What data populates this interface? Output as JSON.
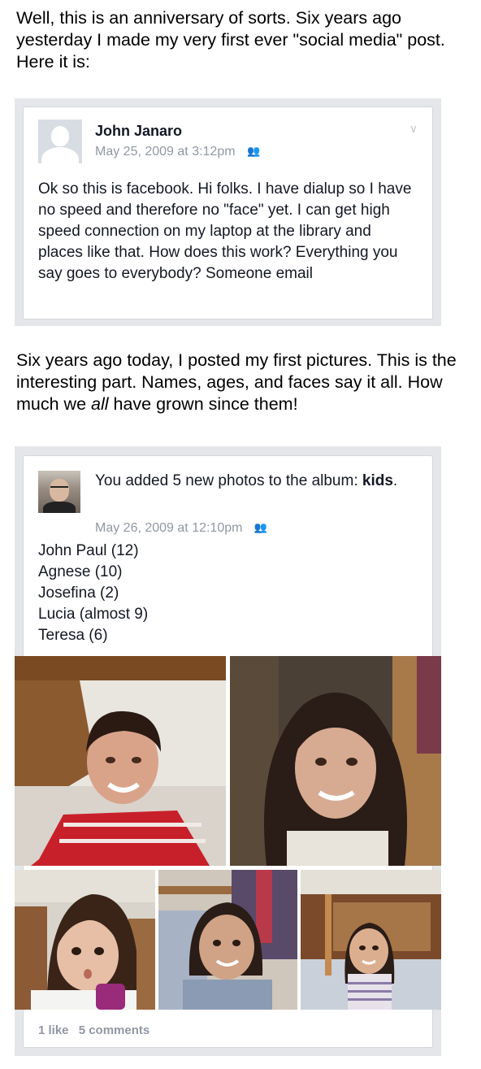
{
  "caption1": "Well, this is an anniversary of sorts. Six years ago yesterday I made my very first ever \"social media\" post. Here it is:",
  "post1": {
    "author": "John Janaro",
    "timestamp": "May 25, 2009 at 3:12pm",
    "text": "Ok so this is facebook.  Hi folks.  I have dialup so I have no speed and therefore no \"face\" yet.  I can get high speed connection on my laptop at the library and places like that.  How does this work?  Everything you say goes to everybody?  Someone email"
  },
  "caption2_before": "Six years ago today, I posted my first pictures. This is the interesting part. Names, ages, and faces say it all. How much we ",
  "caption2_italic": "all",
  "caption2_after": " have grown since them!",
  "post2": {
    "action": "You added 5 new photos to the album:",
    "album": "kids",
    "album_punct": ".",
    "timestamp": "May 26, 2009 at 12:10pm",
    "names": [
      "John Paul (12)",
      "Agnese (10)",
      "Josefina (2)",
      "Lucia (almost 9)",
      "Teresa (6)"
    ],
    "likes": "1 like",
    "comments": "5 comments"
  },
  "icons": {
    "privacy": "friends-icon",
    "chevron": "chevron-down-icon",
    "avatar": "default-avatar-icon"
  },
  "colors": {
    "feed_bg": "#e5e6e9",
    "meta_gray": "#9197a3",
    "text_dark": "#141823"
  }
}
